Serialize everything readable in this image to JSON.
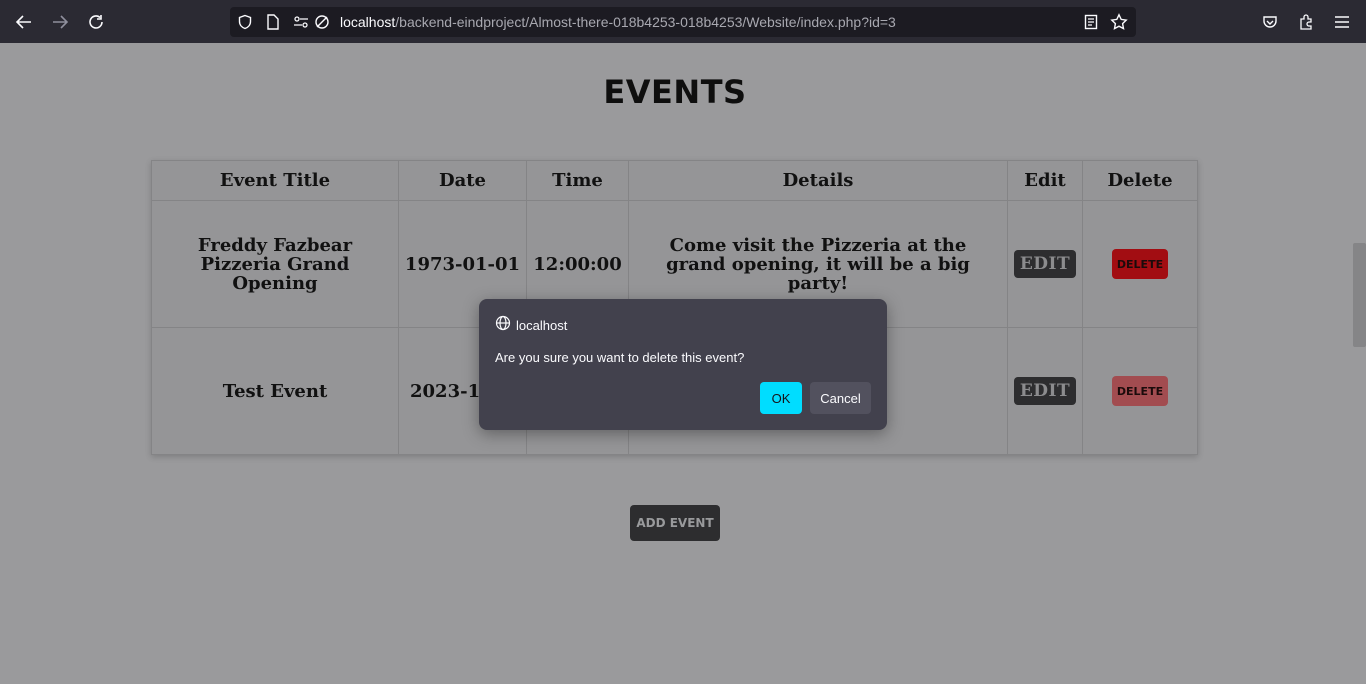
{
  "browser": {
    "url_host": "localhost",
    "url_path": "/backend-eindproject/Almost-there-018b4253-018b4253/Website/index.php?id=3",
    "icons": [
      "back-arrow-icon",
      "forward-arrow-icon",
      "reload-icon",
      "shield-icon",
      "page-icon",
      "permissions-icon",
      "tracking-protection-icon",
      "reader-view-icon",
      "bookmark-star-icon",
      "pocket-icon",
      "extensions-icon",
      "menu-icon"
    ]
  },
  "page": {
    "heading": "EVENTS",
    "table": {
      "headers": [
        "Event Title",
        "Date",
        "Time",
        "Details",
        "Edit",
        "Delete"
      ],
      "rows": [
        {
          "title": "Freddy Fazbear Pizzeria Grand Opening",
          "date": "1973-01-01",
          "time": "12:00:00",
          "details": "Come visit the Pizzeria at the grand opening, it will be a big party!",
          "edit": "EDIT",
          "delete": "DELETE"
        },
        {
          "title": "Test Event",
          "date": "2023-12",
          "time": "",
          "details": "",
          "edit": "EDIT",
          "delete": "DELETE"
        }
      ]
    },
    "add_button": "ADD EVENT"
  },
  "dialog": {
    "host": "localhost",
    "message": "Are you sure you want to delete this event?",
    "ok": "OK",
    "cancel": "Cancel"
  },
  "colors": {
    "toolbar": "#2b2a33",
    "dialog": "#42414d",
    "ok_accent": "#00ddff",
    "delete_red": "#a20d12"
  }
}
